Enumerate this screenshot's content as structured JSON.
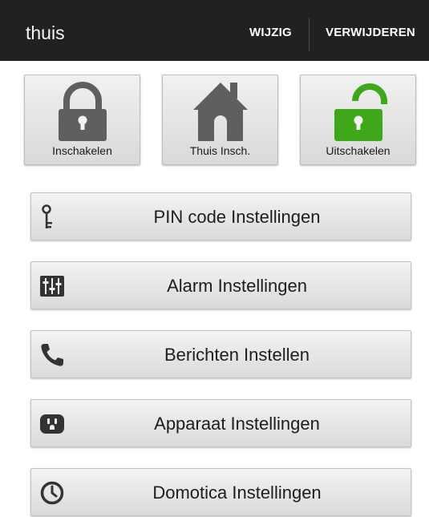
{
  "action_bar": {
    "title": "thuis",
    "edit_label": "WIJZIG",
    "delete_label": "VERWIJDEREN"
  },
  "mode_tiles": [
    {
      "label": "Inschakelen",
      "icon": "lock-closed-icon"
    },
    {
      "label": "Thuis Insch.",
      "icon": "house-icon"
    },
    {
      "label": "Uitschakelen",
      "icon": "lock-open-icon"
    }
  ],
  "settings_menu": [
    {
      "label": "PIN code Instellingen",
      "icon": "key-icon"
    },
    {
      "label": "Alarm Instellingen",
      "icon": "sliders-icon"
    },
    {
      "label": "Berichten Instellen",
      "icon": "phone-icon"
    },
    {
      "label": "Apparaat Instellingen",
      "icon": "socket-icon"
    },
    {
      "label": "Domotica Instellingen",
      "icon": "clock-icon"
    }
  ],
  "colors": {
    "action_bar_bg": "#212121",
    "armed_icon": "#5f5f5f",
    "disarmed_icon": "#3fa81a"
  }
}
